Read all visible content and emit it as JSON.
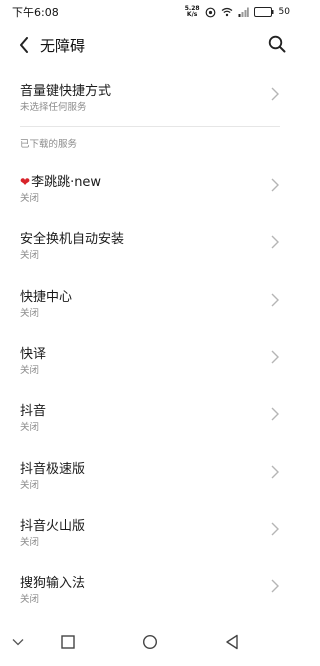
{
  "status_bar": {
    "time": "下午6:08",
    "net_speed_value": "5.28",
    "net_speed_unit": "K/s",
    "battery": "50"
  },
  "header": {
    "title": "无障碍"
  },
  "volume_shortcut": {
    "title": "音量键快捷方式",
    "subtitle": "未选择任何服务"
  },
  "downloaded_section": {
    "header": "已下载的服务",
    "items": [
      {
        "label": "李跳跳·new",
        "status": "关闭"
      },
      {
        "label": "安全换机自动安装",
        "status": "关闭"
      },
      {
        "label": "快捷中心",
        "status": "关闭"
      },
      {
        "label": "快译",
        "status": "关闭"
      },
      {
        "label": "抖音",
        "status": "关闭"
      },
      {
        "label": "抖音极速版",
        "status": "关闭"
      },
      {
        "label": "抖音火山版",
        "status": "关闭"
      },
      {
        "label": "搜狗输入法",
        "status": "关闭"
      }
    ]
  },
  "colors": {
    "heart": "#d8232a",
    "subtitle": "#8c8c8c",
    "chevron": "#b5b5b5"
  },
  "icons": {
    "heart": "heart-icon",
    "back": "back-arrow-icon",
    "search": "search-icon",
    "chevron": "chevron-right-icon"
  }
}
